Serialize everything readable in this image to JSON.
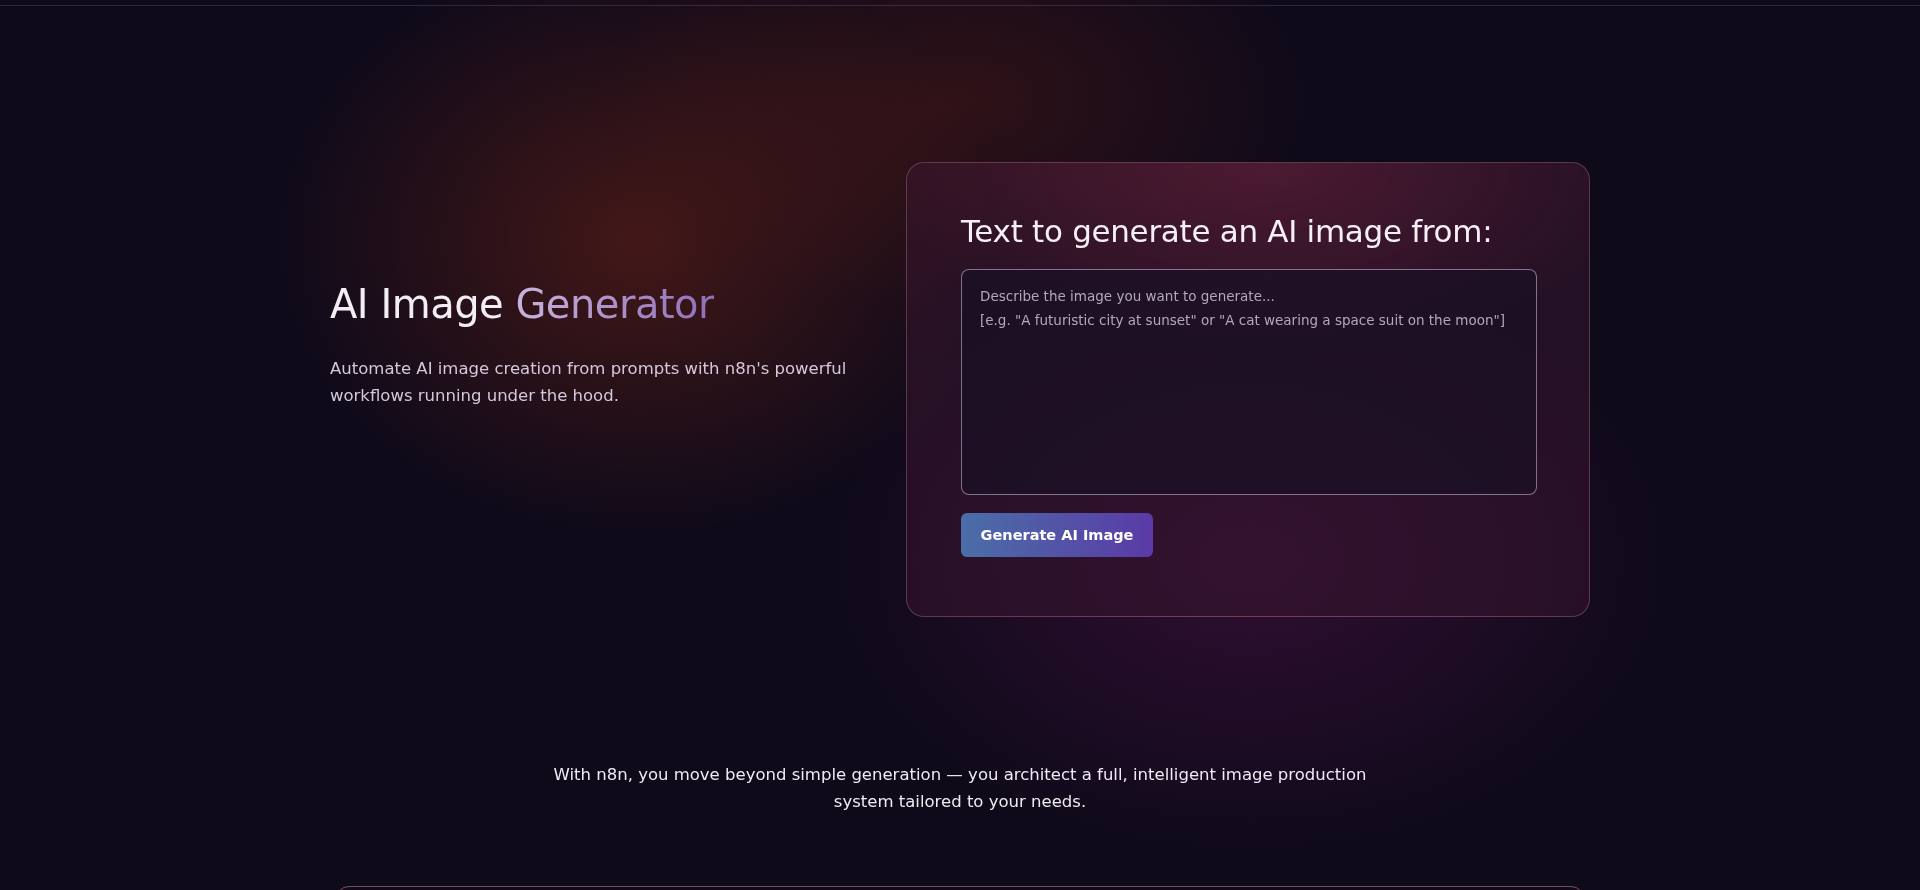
{
  "hero": {
    "title": "AI Image",
    "title_highlight": "Generator",
    "description": "Automate AI image creation from prompts with n8n's powerful workflows running under the hood."
  },
  "form": {
    "heading": "Text to generate an AI image from:",
    "prompt": {
      "placeholder": "Describe the image you want to generate...\n[e.g. \"A futuristic city at sunset\" or \"A cat wearing a space suit on the moon\"]"
    },
    "button": "Generate AI Image"
  },
  "closing": {
    "text": "With n8n, you move beyond simple generation — you architect a full, intelligent image production system tailored to your needs."
  }
}
